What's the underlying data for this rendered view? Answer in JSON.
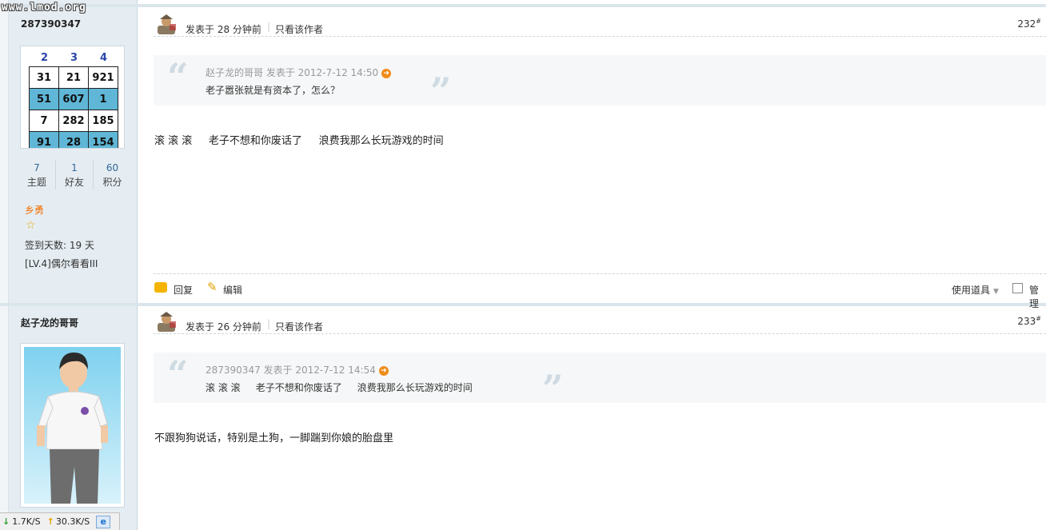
{
  "watermark": "www.lmod.org",
  "posts": [
    {
      "author": "287390347",
      "avatar_grid": {
        "header": [
          "2",
          "3",
          "4"
        ],
        "rows": [
          [
            "31",
            "21",
            "921"
          ],
          [
            "51",
            "607",
            "1"
          ],
          [
            "7",
            "282",
            "185"
          ],
          [
            "91",
            "28",
            "154"
          ]
        ]
      },
      "stats": [
        {
          "value": "7",
          "label": "主题"
        },
        {
          "value": "1",
          "label": "好友"
        },
        {
          "value": "60",
          "label": "积分"
        }
      ],
      "rank": "乡勇",
      "sign_days": "签到天数: 19 天",
      "level": "[LV.4]偶尔看看III",
      "posted": "发表于 28 分钟前",
      "only_author": "只看该作者",
      "floor": "232",
      "floor_mark": "#",
      "quote": {
        "meta": "赵子龙的哥哥 发表于 2012-7-12 14:50",
        "body": "老子嚣张就是有资本了，怎么？"
      },
      "message": "滚 滚 滚     老子不想和你废话了     浪费我那么长玩游戏的时间",
      "actions": {
        "reply": "回复",
        "edit": "编辑",
        "tools": "使用道具",
        "manage": "管理"
      }
    },
    {
      "author": "赵子龙的哥哥",
      "posted": "发表于 26 分钟前",
      "only_author": "只看该作者",
      "floor": "233",
      "floor_mark": "#",
      "quote": {
        "meta": "287390347 发表于 2012-7-12 14:54",
        "body": "滚 滚 滚     老子不想和你废话了     浪费我那么长玩游戏的时间"
      },
      "message": "不跟狗狗说话，特别是土狗，一脚踹到你娘的胎盘里"
    }
  ],
  "statusbar": {
    "download": "1.7K/S",
    "upload": "30.3K/S"
  }
}
